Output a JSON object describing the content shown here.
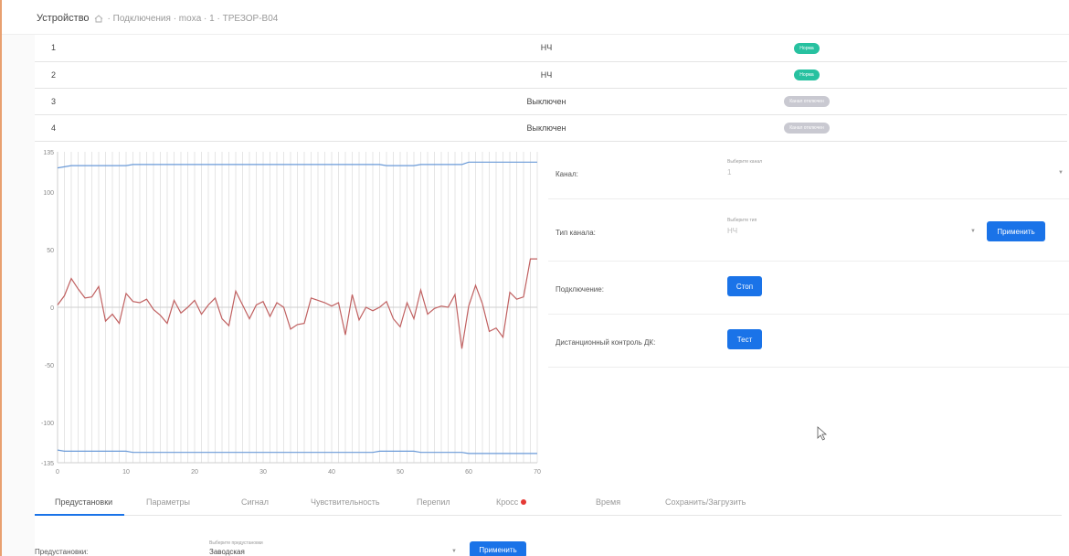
{
  "breadcrumb": {
    "title": "Устройство",
    "path": "· Подключения · moxa · 1 · ТРЕЗОР-В04"
  },
  "channels": [
    {
      "num": "1",
      "mode": "НЧ",
      "status": "Норма",
      "status_kind": "ok"
    },
    {
      "num": "2",
      "mode": "НЧ",
      "status": "Норма",
      "status_kind": "ok"
    },
    {
      "num": "3",
      "mode": "Выключен",
      "status": "Канал отключен",
      "status_kind": "off"
    },
    {
      "num": "4",
      "mode": "Выключен",
      "status": "Канал отключен",
      "status_kind": "off"
    }
  ],
  "colors": {
    "accent": "#1a73e8",
    "badge_ok": "#27c1a0",
    "badge_off": "#c9c9d1",
    "signal": "#c06060",
    "threshold": "#6a9ad8"
  },
  "settings": {
    "channel": {
      "label": "Канал:",
      "hint": "Выберите канал",
      "value": "1"
    },
    "channel_type": {
      "label": "Тип канала:",
      "hint": "Выберите тип",
      "value": "НЧ",
      "button": "Применить"
    },
    "connection": {
      "label": "Подключение:",
      "button": "Стоп"
    },
    "remote_control": {
      "label": "Дистанционный контроль ДК:",
      "button": "Тест"
    }
  },
  "tabs": [
    {
      "label": "Предустановки",
      "active": true
    },
    {
      "label": "Параметры",
      "active": false
    },
    {
      "label": "Сигнал",
      "active": false
    },
    {
      "label": "Чувствительность",
      "active": false
    },
    {
      "label": "Перепил",
      "active": false
    },
    {
      "label": "Кросс",
      "active": false,
      "alert": true
    },
    {
      "label": "Время",
      "active": false
    },
    {
      "label": "Сохранить/Загрузить",
      "active": false
    }
  ],
  "presets": {
    "label": "Предустановки:",
    "hint": "Выберите предустановки",
    "value": "Заводская",
    "button": "Применить"
  },
  "chart_data": {
    "type": "line",
    "title": "",
    "xlabel": "",
    "ylabel": "",
    "xlim": [
      0,
      70
    ],
    "ylim": [
      -135,
      135
    ],
    "x_ticks": [
      0,
      10,
      20,
      30,
      40,
      50,
      60,
      70
    ],
    "y_ticks": [
      135,
      100,
      50,
      0,
      -50,
      -100,
      -135
    ],
    "grid": true,
    "series": [
      {
        "role": "signal",
        "color": "#c06060",
        "x": [
          0,
          1,
          2,
          3,
          4,
          5,
          6,
          7,
          8,
          9,
          10,
          11,
          12,
          13,
          14,
          15,
          16,
          17,
          18,
          19,
          20,
          21,
          22,
          23,
          24,
          25,
          26,
          27,
          28,
          29,
          30,
          31,
          32,
          33,
          34,
          35,
          36,
          37,
          38,
          39,
          40,
          41,
          42,
          43,
          44,
          45,
          46,
          47,
          48,
          49,
          50,
          51,
          52,
          53,
          54,
          55,
          56,
          57,
          58,
          59,
          60,
          61,
          62,
          63,
          64,
          65,
          66,
          67,
          68,
          69,
          70
        ],
        "y": [
          2,
          10,
          25,
          16,
          8,
          9,
          18,
          -12,
          -6,
          -14,
          12,
          5,
          4,
          7,
          -2,
          -7,
          -14,
          6,
          -5,
          0,
          6,
          -6,
          2,
          8,
          -10,
          -16,
          14,
          2,
          -10,
          2,
          5,
          -8,
          4,
          0,
          -19,
          -15,
          -14,
          8,
          6,
          4,
          1,
          4,
          -24,
          11,
          -11,
          0,
          -3,
          0,
          5,
          -10,
          -17,
          4,
          -10,
          15,
          -6,
          -1,
          1,
          0,
          11,
          -36,
          1,
          19,
          3,
          -21,
          -18,
          -26,
          13,
          7,
          9,
          42,
          42
        ]
      },
      {
        "role": "upper-threshold",
        "color": "#6a9ad8",
        "x": [
          0,
          1,
          2,
          10,
          11,
          47,
          48,
          52,
          53,
          59,
          60,
          70
        ],
        "y": [
          121,
          122,
          123,
          123,
          124,
          124,
          123,
          123,
          124,
          124,
          126,
          126
        ]
      },
      {
        "role": "lower-threshold",
        "color": "#6a9ad8",
        "x": [
          0,
          1,
          2,
          10,
          11,
          46,
          47,
          52,
          53,
          59,
          60,
          70
        ],
        "y": [
          -124,
          -125,
          -125,
          -125,
          -126,
          -126,
          -125,
          -125,
          -126,
          -126,
          -127,
          -127
        ]
      }
    ]
  }
}
